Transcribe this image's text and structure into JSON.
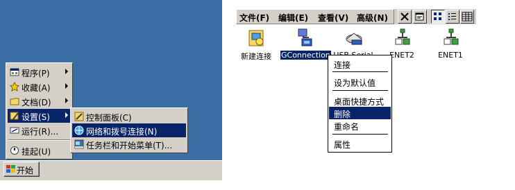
{
  "desktop": {
    "start_label": "开始"
  },
  "start_menu": {
    "items": [
      {
        "label": "程序(P)",
        "icon": "programs-icon"
      },
      {
        "label": "收藏(A)",
        "icon": "favorites-icon"
      },
      {
        "label": "文档(D)",
        "icon": "documents-icon"
      },
      {
        "label": "设置(S)",
        "icon": "settings-icon"
      },
      {
        "label": "运行(R)...",
        "icon": "run-icon"
      },
      {
        "label": "挂起(U)",
        "icon": "suspend-icon"
      }
    ]
  },
  "settings_menu": {
    "items": [
      {
        "label": "控制面板(C)",
        "icon": "control-panel-icon"
      },
      {
        "label": "网络和拨号连接(N)",
        "icon": "network-icon"
      },
      {
        "label": "任务栏和开始菜单(T)...",
        "icon": "taskbar-icon"
      }
    ]
  },
  "explorer": {
    "menu": [
      "文件(F)",
      "编辑(E)",
      "查看(V)",
      "高级(N)"
    ],
    "toolbar": [
      "close-icon",
      "properties-icon",
      "large-icons-view-icon",
      "list-view-icon",
      "details-view-icon"
    ],
    "connections": [
      {
        "label": "新建连接",
        "icon": "new-connection-icon"
      },
      {
        "label": "GConnection",
        "icon": "dialup-connection-icon"
      },
      {
        "label": "USB Serial",
        "icon": "usb-serial-icon"
      },
      {
        "label": "ENET2",
        "icon": "ethernet-icon"
      },
      {
        "label": "ENET1",
        "icon": "ethernet-icon"
      }
    ]
  },
  "context_menu": {
    "connect": "连接",
    "set_default": "设为默认值",
    "desktop_shortcut": "桌面快捷方式",
    "delete": "删除",
    "rename": "重命名",
    "properties": "属性"
  },
  "colors": {
    "desktop": "#3a6ea5",
    "face": "#d4d0c8",
    "highlight": "#0a246a"
  }
}
